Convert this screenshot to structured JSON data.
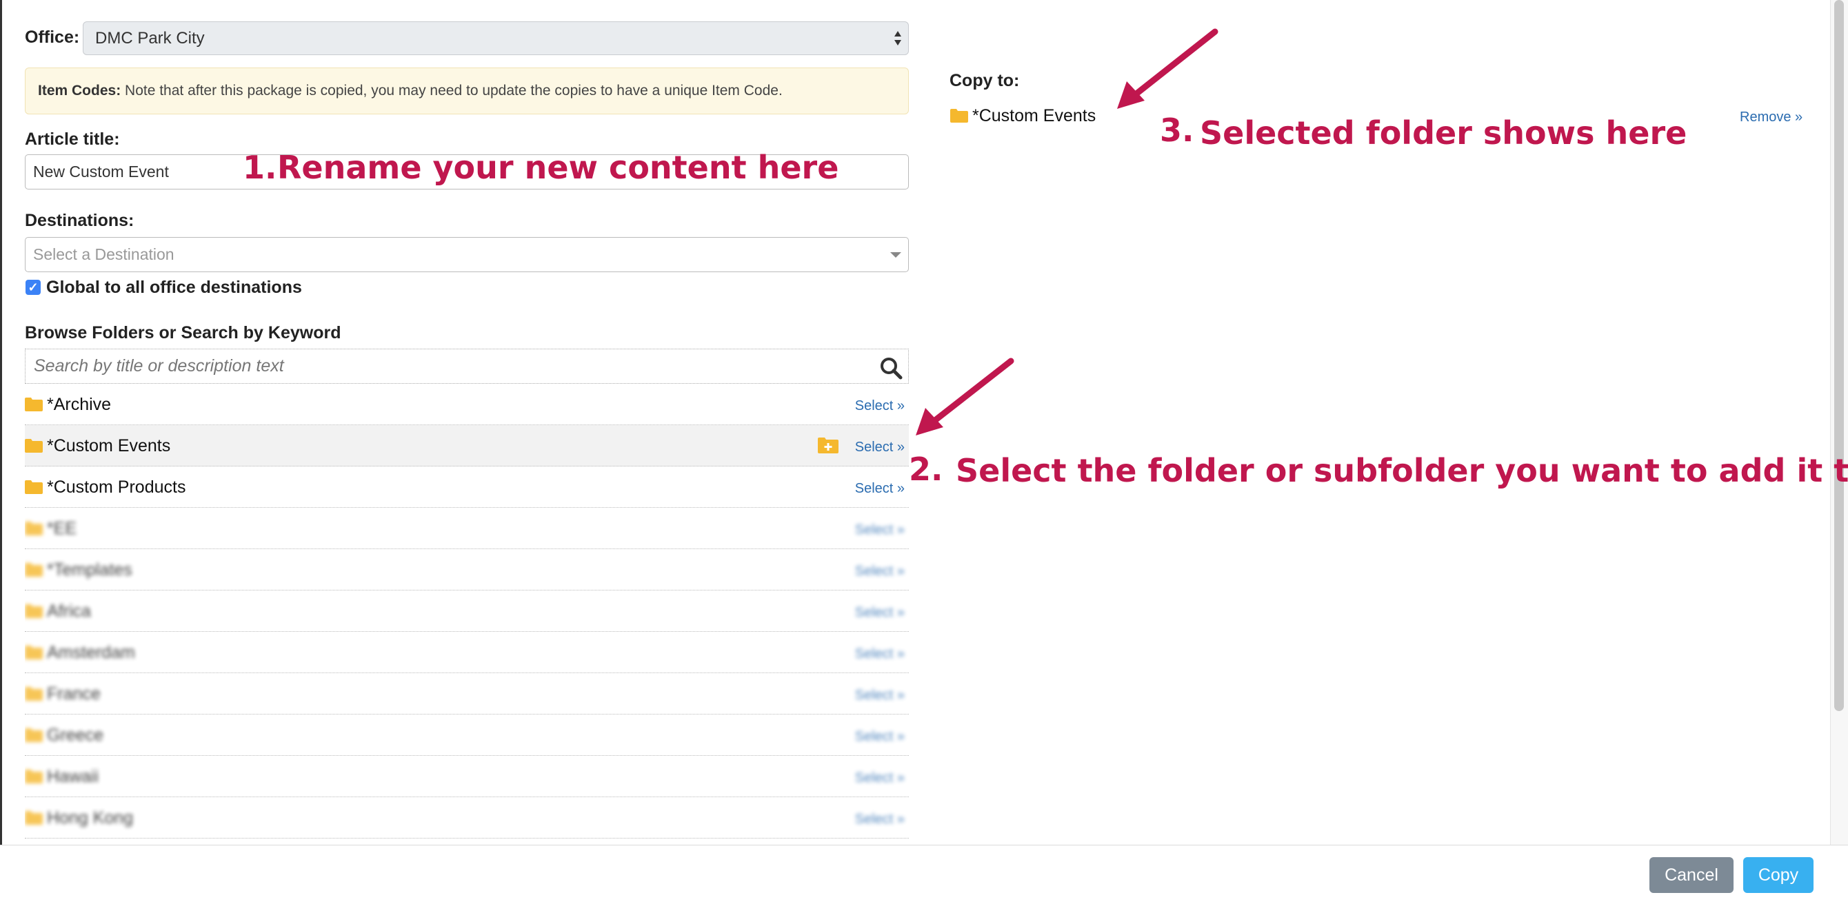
{
  "form": {
    "office_label": "Office:",
    "office_value": "DMC Park City",
    "notice_bold": "Item Codes:",
    "notice_text": " Note that after this package is copied, you may need to update the copies to have a unique Item Code.",
    "article_title_label": "Article title:",
    "article_title_value": "New Custom Event",
    "destinations_label": "Destinations:",
    "destinations_placeholder": "Select a Destination",
    "global_checkbox_label": "Global to all office destinations",
    "global_checked": true,
    "browse_label": "Browse Folders or Search by Keyword",
    "search_placeholder": "Search by title or description text"
  },
  "folders": [
    {
      "name": "*Archive",
      "select": "Select »"
    },
    {
      "name": "*Custom Events",
      "select": "Select »"
    },
    {
      "name": "*Custom Products",
      "select": "Select »"
    },
    {
      "name": "*EE",
      "select": "Select »"
    },
    {
      "name": "*Templates",
      "select": "Select »"
    },
    {
      "name": "Africa",
      "select": "Select »"
    },
    {
      "name": "Amsterdam",
      "select": "Select »"
    },
    {
      "name": "France",
      "select": "Select »"
    },
    {
      "name": "Greece",
      "select": "Select »"
    },
    {
      "name": "Hawaii",
      "select": "Select »"
    },
    {
      "name": "Hong Kong",
      "select": "Select »"
    }
  ],
  "copy_to": {
    "label": "Copy to:",
    "folder": "*Custom Events",
    "remove": "Remove »"
  },
  "footer": {
    "cancel": "Cancel",
    "copy": "Copy"
  },
  "annotations": {
    "step1_num": "1.",
    "step1_text": "Rename your new content here",
    "step2_num": "2.",
    "step2_text": "Select the folder  or subfolder you want to add it to",
    "step3_num": "3.",
    "step3_text": "Selected folder shows here"
  },
  "colors": {
    "annotation": "#c0174e",
    "folder": "#f5b82e",
    "link": "#2b6cb0",
    "cancel_button": "#7d8a96",
    "copy_button": "#38b0f0"
  }
}
